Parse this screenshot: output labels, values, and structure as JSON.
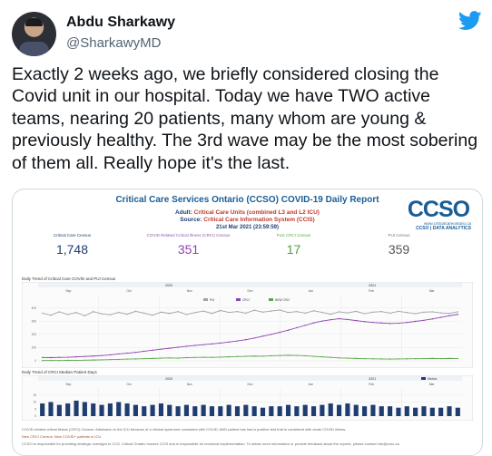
{
  "author": {
    "display_name": "Abdu Sharkawy",
    "handle": "@SharkawyMD"
  },
  "tweet": {
    "text": "Exactly 2 weeks ago, we briefly considered closing the Covid unit in our hospital. Today we have TWO active teams, nearing 20 patients, many whom are young & previously healthy. The 3rd wave may be the most sobering of them all. Really hope it's the last."
  },
  "report": {
    "title": "Critical Care Services Ontario (CCSO) COVID-19 Daily Report",
    "adult_label": "Adult:",
    "adult_value": "Critical Care Units (combined L3 and L2 ICU)",
    "source_label": "Source:",
    "source_value": "Critical Care Information System (CCIS)",
    "date": "21st Mar 2021 (23:59:59)",
    "logo_text": "CCSO",
    "logo_url": "www.criticalcareontario.ca",
    "logo_sub": "CCSO | DATA ANALYTICS",
    "metrics": [
      {
        "label": "Critical Care Census",
        "value": "1,748"
      },
      {
        "label": "COVID Related Critical Illness (CRCI) Census",
        "value": "351"
      },
      {
        "label": "Post CRCI Census",
        "value": "17"
      },
      {
        "label": "PUI Census",
        "value": "359"
      }
    ],
    "chart1_title": "Daily Trend of Critical Care COVID and PUI Census",
    "chart2_title": "Daily Trend of CRCI Median Patient Days",
    "footnotes": [
      "COVID-related critical illness (CRCI) Census: Admission to the ICU because of a clinical syndrome consistent with COVID, AND patient has had a positive test that is consistent with acute COVID illness.",
      "New CRCI Census: New COVID+ patients in ICU.",
      "CCSO is responsible for providing strategic oversight to CCS. Critical Ontario houses CCIS and is responsible for technical implementation. To obtain more information or provide feedback about the reports, please contact info@ccso.ca"
    ]
  },
  "chart_data": [
    {
      "type": "line",
      "title": "Daily Trend of Critical Care COVID and PUI Census",
      "x_groups": [
        "2020",
        "2021"
      ],
      "x_months": [
        "Sep",
        "Oct",
        "Nov",
        "Dec",
        "Jan",
        "Feb",
        "Mar"
      ],
      "legend": [
        "PUI",
        "CRCI",
        "NEW CRCI"
      ],
      "ylim": [
        0,
        500
      ],
      "y_ticks": [
        0,
        100,
        200,
        300,
        400
      ],
      "series": [
        {
          "name": "PUI",
          "color": "#9aa3ad",
          "values": [
            360,
            345,
            370,
            350,
            365,
            340,
            372,
            355,
            348,
            366,
            352,
            374,
            360,
            345,
            368,
            358,
            372,
            350,
            364,
            376,
            358,
            380,
            366,
            372,
            360,
            382,
            368,
            376,
            384,
            365,
            372,
            360,
            378,
            366,
            352,
            370,
            362,
            374,
            356,
            368,
            372,
            360,
            374,
            365,
            356,
            368,
            370,
            362,
            358,
            370
          ]
        },
        {
          "name": "CRCI",
          "color": "#8e44ad",
          "values": [
            25,
            24,
            26,
            27,
            30,
            33,
            36,
            40,
            45,
            52,
            58,
            64,
            72,
            80,
            88,
            95,
            102,
            110,
            116,
            122,
            128,
            134,
            142,
            150,
            160,
            172,
            186,
            200,
            215,
            232,
            250,
            268,
            286,
            300,
            310,
            318,
            312,
            304,
            296,
            290,
            286,
            282,
            284,
            290,
            298,
            306,
            316,
            328,
            340,
            351
          ]
        },
        {
          "name": "NEW CRCI",
          "color": "#5ba84a",
          "values": [
            2,
            3,
            2,
            4,
            3,
            5,
            6,
            7,
            9,
            11,
            13,
            14,
            16,
            18,
            20,
            22,
            20,
            24,
            25,
            27,
            26,
            28,
            30,
            32,
            34,
            36,
            35,
            38,
            40,
            42,
            41,
            38,
            34,
            30,
            26,
            22,
            20,
            18,
            16,
            15,
            14,
            13,
            14,
            15,
            16,
            17,
            18,
            17,
            18,
            17
          ]
        }
      ]
    },
    {
      "type": "bar",
      "title": "Daily Trend of CRCI Median Patient Days",
      "x_groups": [
        "2020",
        "2021"
      ],
      "x_months": [
        "Sep",
        "Oct",
        "Nov",
        "Dec",
        "Jan",
        "Feb",
        "Mar"
      ],
      "legend": [
        "Median"
      ],
      "ylim": [
        0,
        20
      ],
      "y_ticks": [
        0,
        5,
        10,
        15
      ],
      "series": [
        {
          "name": "Median",
          "color": "#1f3d70",
          "values": [
            9,
            10,
            8,
            9,
            11,
            10,
            9,
            8,
            9,
            10,
            9,
            8,
            7,
            8,
            9,
            8,
            7,
            8,
            7,
            8,
            7,
            7,
            8,
            7,
            8,
            7,
            6,
            7,
            7,
            8,
            7,
            8,
            7,
            8,
            9,
            8,
            9,
            8,
            7,
            8,
            7,
            7,
            6,
            7,
            6,
            7,
            6,
            6,
            7,
            6
          ]
        }
      ]
    }
  ]
}
